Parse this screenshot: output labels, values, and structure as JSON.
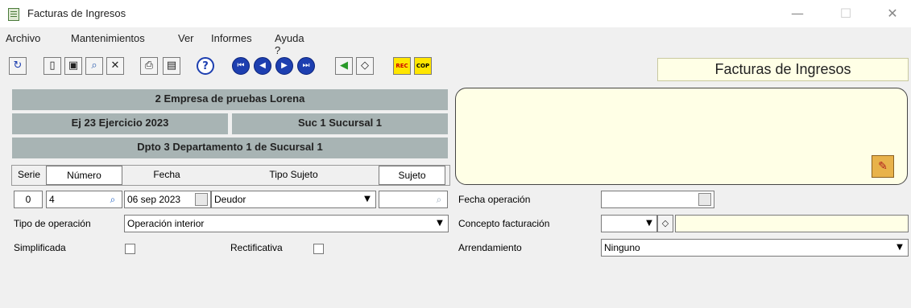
{
  "window": {
    "title": "Facturas de Ingresos",
    "minimize": "—",
    "maximize": "☐",
    "close": "✕"
  },
  "menu": {
    "archivo": "Archivo",
    "mantenimientos": "Mantenimientos",
    "ver": "Ver",
    "informes": "Informes",
    "ayuda": "Ayuda ?"
  },
  "toolbar_icons": [
    "refresh-icon",
    "new-document-icon",
    "save-icon",
    "search-icon",
    "delete-icon",
    "print-icon",
    "view-icon",
    "help-icon",
    "first-record-icon",
    "previous-record-icon",
    "next-record-icon",
    "last-record-icon",
    "arrow-icon",
    "eraser-icon",
    "rec-icon",
    "cop-icon"
  ],
  "toolbar_labels": {
    "rec": "REC",
    "cop": "COP"
  },
  "header_title": "Facturas de Ingresos",
  "context": {
    "empresa": "2 Empresa de pruebas Lorena",
    "ejercicio": "Ej 23 Ejercicio 2023",
    "sucursal": "Suc 1 Sucursal 1",
    "departamento": "Dpto 3 Departamento 1 de Sucursal 1"
  },
  "grid_headers": {
    "serie": "Serie",
    "numero": "Número",
    "fecha": "Fecha",
    "tipo_sujeto": "Tipo Sujeto",
    "sujeto": "Sujeto"
  },
  "row": {
    "serie": "0",
    "numero": "4",
    "fecha": "06 sep 2023",
    "tipo_sujeto": "Deudor",
    "sujeto": ""
  },
  "labels": {
    "tipo_operacion": "Tipo de operación",
    "simplificada": "Simplificada",
    "rectificativa": "Rectificativa",
    "fecha_operacion": "Fecha operación",
    "concepto_facturacion": "Concepto facturación",
    "arrendamiento": "Arrendamiento"
  },
  "values": {
    "tipo_operacion": "Operación interior",
    "fecha_operacion": "",
    "concepto_facturacion": "",
    "arrendamiento": "Ninguno",
    "simplificada_checked": false,
    "rectificativa_checked": false
  },
  "colors": {
    "grey_bar": "#a8b4b4",
    "note_bg": "#ffffe6",
    "nav_blue": "#1d3fb0"
  }
}
